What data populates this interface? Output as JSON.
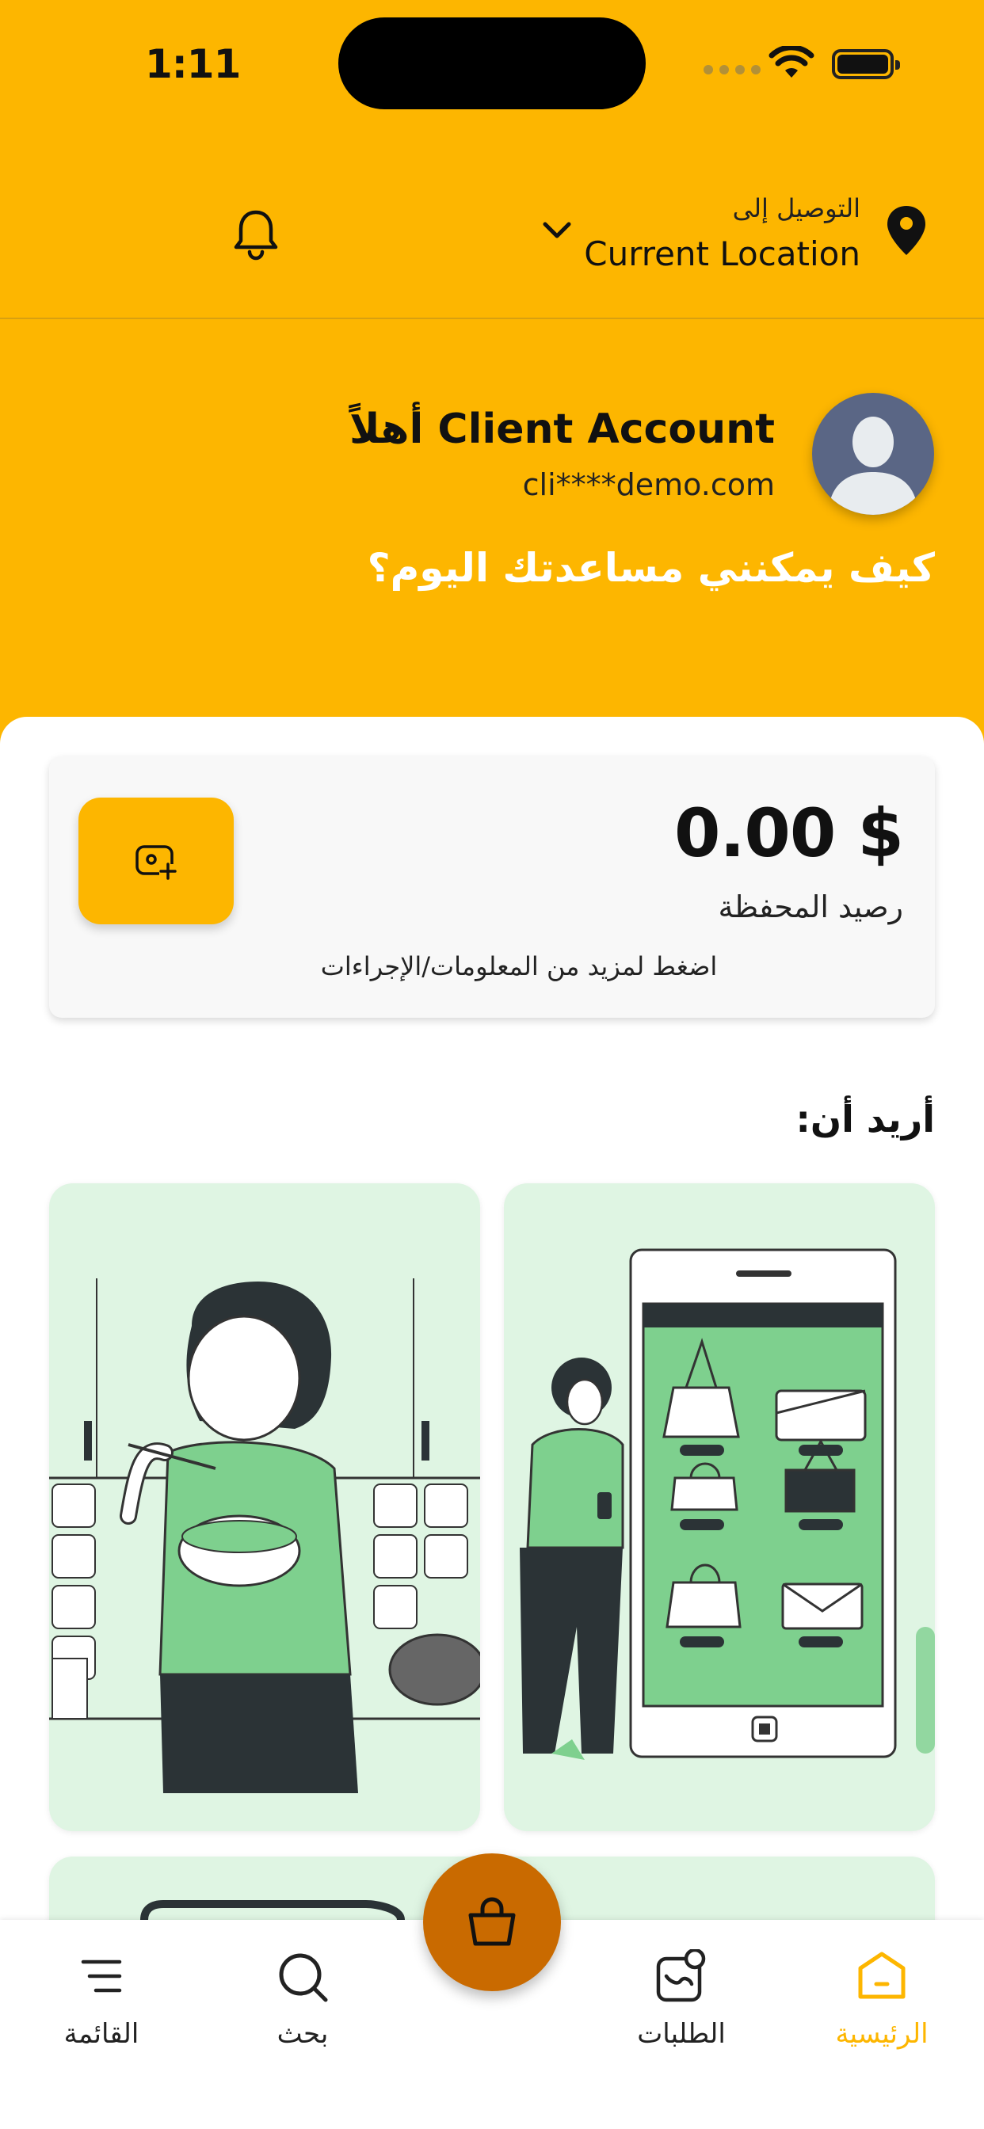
{
  "status_bar": {
    "time": "1:11"
  },
  "location": {
    "title": "التوصيل إلى",
    "value": "Current Location"
  },
  "profile": {
    "greeting": "أهلاً Client Account",
    "email": "cli****demo.com"
  },
  "help_text": "كيف يمكنني مساعدتك اليوم؟",
  "wallet": {
    "amount": "0.00 $",
    "label": "رصيد المحفظة",
    "hint": "اضغط لمزيد من المعلومات/الإجراءات"
  },
  "want_section": {
    "title": "أريد أن:"
  },
  "bottom_nav": {
    "home": "الرئيسية",
    "orders": "الطلبات",
    "search": "بحث",
    "menu": "القائمة"
  },
  "colors": {
    "brand": "#FDB600",
    "fab": "#C96A00",
    "tile": "#DFF5E3",
    "illustration_green": "#7ED08E"
  }
}
